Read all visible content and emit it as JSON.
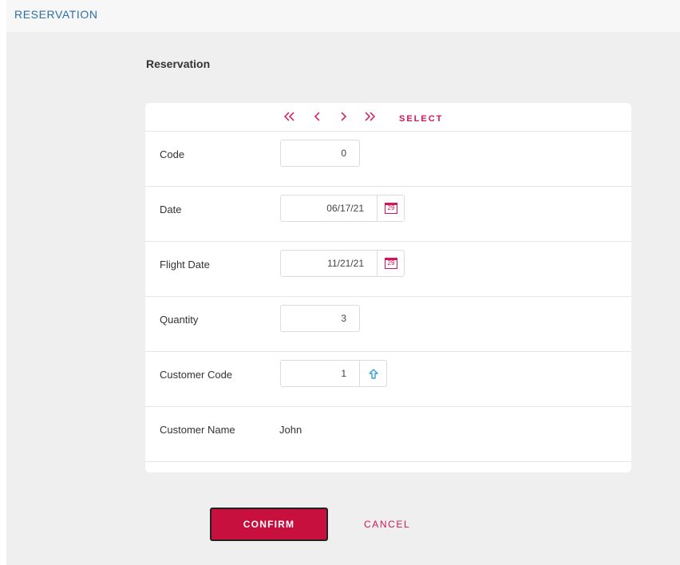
{
  "header": {
    "app_title": "RESERVATION"
  },
  "page": {
    "title": "Reservation"
  },
  "navigation": {
    "first_icon": "double-chevron-left-icon",
    "prev_icon": "chevron-left-icon",
    "next_icon": "chevron-right-icon",
    "last_icon": "double-chevron-right-icon",
    "select_label": "SELECT"
  },
  "form": {
    "code": {
      "label": "Code",
      "value": "0"
    },
    "date": {
      "label": "Date",
      "value": "06/17/21",
      "button_icon": "calendar-icon",
      "icon_text": "29"
    },
    "flight_date": {
      "label": "Flight Date",
      "value": "11/21/21",
      "button_icon": "calendar-icon",
      "icon_text": "29"
    },
    "quantity": {
      "label": "Quantity",
      "value": "3"
    },
    "customer_code": {
      "label": "Customer Code",
      "value": "1",
      "button_icon": "arrow-up-icon"
    },
    "customer_name": {
      "label": "Customer Name",
      "value": "John"
    }
  },
  "actions": {
    "confirm_label": "CONFIRM",
    "cancel_label": "CANCEL"
  },
  "colors": {
    "accent": "#d4145a",
    "confirm_bg": "#c8103f",
    "header_text": "#2a6fa8",
    "arrow_icon": "#3a9fd9"
  }
}
